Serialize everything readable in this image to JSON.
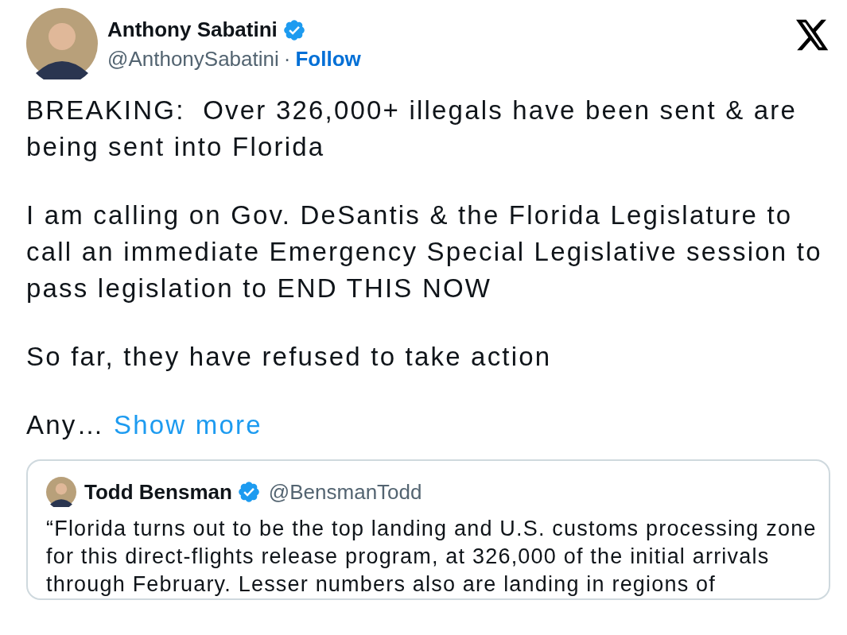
{
  "author": {
    "name": "Anthony Sabatini",
    "verified": true,
    "handle": "@AnthonySabatini",
    "separator": "·",
    "follow": "Follow"
  },
  "paragraphs": [
    {
      "text": "BREAKING:  Over 326,000+ illegals have been sent & are being sent into Florida"
    },
    {
      "text": "I am calling on Gov. DeSantis & the Florida Legislature to call an immediate Emergency Special Legislative session to pass legislation to END THIS NOW"
    },
    {
      "text": "So far, they have refused to take action"
    },
    {
      "text": "Any…",
      "link": "Show more"
    }
  ],
  "quoted": {
    "name": "Todd Bensman",
    "verified": true,
    "handle": "@BensmanTodd",
    "text": "“Florida turns out to be the top landing and U.S. customs processing zone for this direct-flights release program, at 326,000 of the initial arrivals through February. Lesser numbers also are landing in regions of"
  }
}
